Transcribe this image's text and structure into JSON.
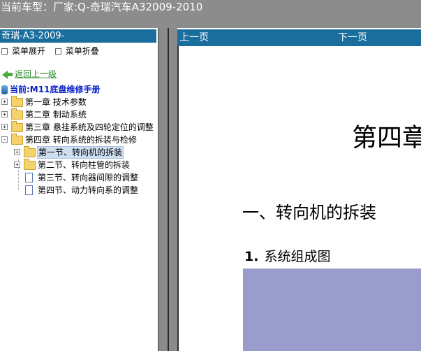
{
  "title": "当前车型：厂家:Q-奇瑞汽车A32009-2010",
  "left": {
    "header": "奇瑞-A3-2009-",
    "expand": "菜单展开",
    "collapse": "菜单折叠",
    "back": "返回上一级",
    "current": "当前:M11底盘维修手册",
    "tree": [
      {
        "label": "第一章  技术参数",
        "toggle": "+"
      },
      {
        "label": "第二章  制动系统",
        "toggle": "+"
      },
      {
        "label": "第三章  悬挂系统及四轮定位的调整",
        "toggle": "+"
      },
      {
        "label": "第四章  转向系统的拆装与检修",
        "toggle": "-"
      },
      {
        "label": "第一节、转向机的拆装",
        "toggle": "+"
      },
      {
        "label": "第二节、转向柱管的拆装",
        "toggle": "+"
      },
      {
        "label": "第三节、转向器间隙的调整"
      },
      {
        "label": "第四节、动力转向系的调整"
      }
    ]
  },
  "right": {
    "prev": "上一页",
    "next": "下一页",
    "chapter": "第四章",
    "section": "一、转向机的拆装",
    "subsection_num": "1.",
    "subsection": "系统组成图"
  },
  "colors": {
    "header_bg": "#1a6e9e",
    "figure_bg": "#9a9ccc",
    "topbar_bg": "#8c8c8c"
  }
}
